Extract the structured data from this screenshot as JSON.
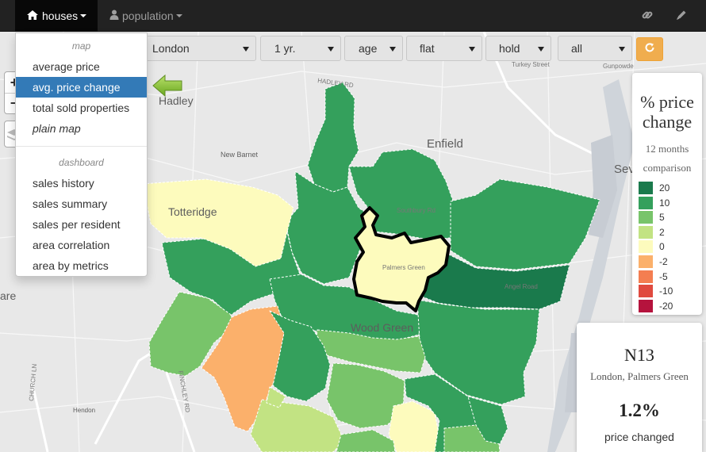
{
  "navbar": {
    "houses_label": "houses",
    "population_label": "population",
    "active_tab": "houses"
  },
  "filters": {
    "city": "London",
    "period": "1 yr.",
    "category": "age",
    "property_type": "flat",
    "tenure": "hold",
    "scope": "all"
  },
  "dropdown": {
    "map_header": "map",
    "map_items": [
      {
        "label": "average price"
      },
      {
        "label": "avg. price change",
        "active": true
      },
      {
        "label": "total sold properties"
      },
      {
        "label": "plain map",
        "italic": true
      }
    ],
    "dashboard_header": "dashboard",
    "dashboard_items": [
      {
        "label": "sales history"
      },
      {
        "label": "sales summary"
      },
      {
        "label": "sales per resident"
      },
      {
        "label": "area correlation"
      },
      {
        "label": "area by metrics"
      }
    ]
  },
  "map": {
    "place_labels": {
      "hadley": "Hadley",
      "enfield": "Enfield",
      "new_barnet": "New Barnet",
      "totteridge": "Totteridge",
      "wood_green": "Wood Green",
      "hendon": "Hendon",
      "are": "are",
      "sev": "Sev",
      "turkey_street": "Turkey Street",
      "gunpowder": "Gunpowde",
      "hadley_rd": "HADLEY RD",
      "finchley_rd": "FINCHLEY RD",
      "church_ln": "CHURCH LN",
      "angel_road": "Angel Road",
      "palmers_green": "Palmers Green",
      "southbury_rd": "Southbury Rd"
    }
  },
  "legend": {
    "title_line1": "% price",
    "title_line2": "change",
    "subtitle_line1": "12 months",
    "subtitle_line2": "comparison",
    "items": [
      {
        "label": "20",
        "color": "#1a7a4c"
      },
      {
        "label": "10",
        "color": "#34a05c"
      },
      {
        "label": "5",
        "color": "#78c46a"
      },
      {
        "label": "2",
        "color": "#c2e383"
      },
      {
        "label": "0",
        "color": "#fdfbbd"
      },
      {
        "label": "-2",
        "color": "#fbb06b"
      },
      {
        "label": "-5",
        "color": "#f47e51"
      },
      {
        "label": "-10",
        "color": "#e04a3f"
      },
      {
        "label": "-20",
        "color": "#b5133d"
      }
    ]
  },
  "info": {
    "postcode": "N13",
    "area": "London, Palmers Green",
    "value": "1.2%",
    "label": "price changed"
  },
  "colors": {
    "accent": "#337ab7",
    "refresh": "#f0ad4e",
    "selected_outline": "#000000"
  }
}
